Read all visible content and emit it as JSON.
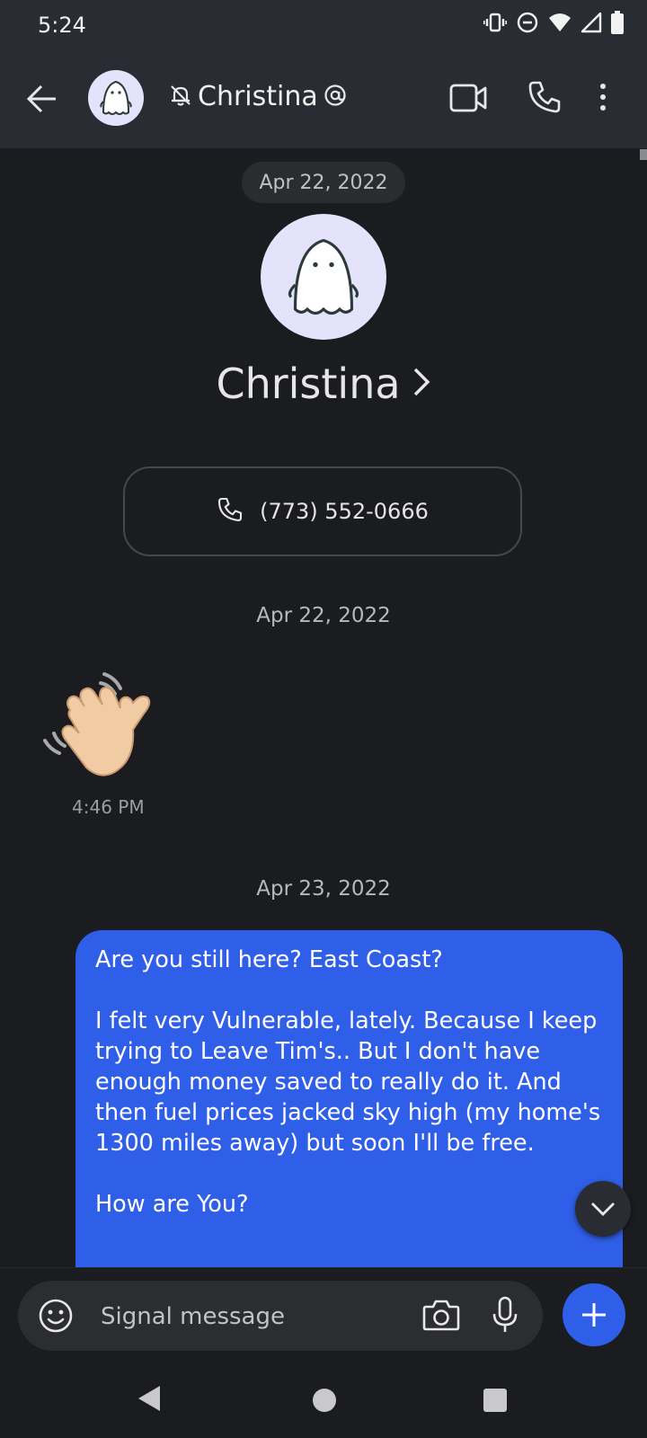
{
  "status_bar": {
    "time": "5:24",
    "icons": [
      "vibrate-icon",
      "do-not-disturb-icon",
      "wifi-icon",
      "signal-icon",
      "battery-icon"
    ]
  },
  "header": {
    "contact_name": "Christina",
    "muted_icon": "bell-off-icon",
    "mention_icon": "at-icon",
    "avatar_icon": "ghost-icon",
    "actions": [
      "video-call-icon",
      "phone-icon",
      "more-vertical-icon"
    ]
  },
  "conversation_header": {
    "floating_date": "Apr 22, 2022",
    "contact_name": "Christina",
    "phone_number": "(773) 552-0666"
  },
  "messages": [
    {
      "date_separator": "Apr 22, 2022",
      "type": "emoji",
      "emoji": "👋",
      "time": "4:46 PM",
      "direction": "incoming"
    },
    {
      "date_separator": "Apr 23, 2022",
      "type": "text",
      "direction": "outgoing",
      "text": "Are you still here? East Coast?\n\nI felt very Vulnerable, lately. Because I keep trying to Leave Tim's.. But I don't have enough money saved to really do it. And then fuel prices jacked sky high (my home's 1300 miles away) but soon I'll be free.\n\nHow are You?"
    }
  ],
  "composer": {
    "placeholder": "Signal message"
  },
  "colors": {
    "background": "#1b1c1f",
    "app_bar": "#2a2c33",
    "outgoing_bubble": "#2f5fe8",
    "avatar_bg": "#e4e3fb",
    "accent": "#2f5fe8"
  }
}
